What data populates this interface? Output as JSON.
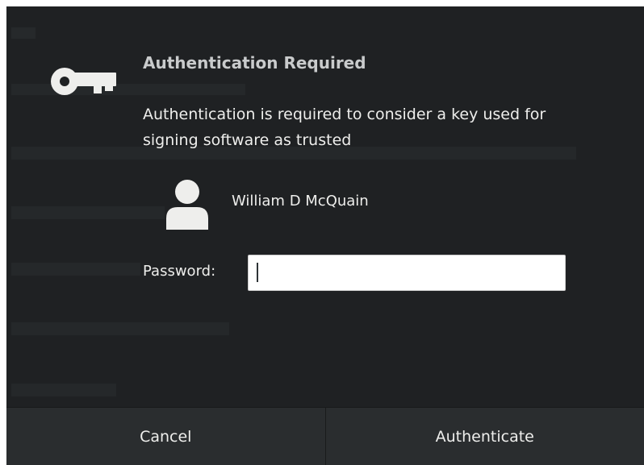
{
  "dialog": {
    "title": "Authentication Required",
    "message": "Authentication is required to consider a key used for signing software as trusted",
    "user_name": "William D McQuain",
    "password_label": "Password:",
    "password_value": "",
    "cancel_label": "Cancel",
    "authenticate_label": "Authenticate"
  },
  "icons": {
    "key": "key-icon",
    "user": "avatar-person-icon"
  },
  "colors": {
    "dialog_background": "#1f2123",
    "button_background": "#2a2d2f",
    "title_text": "#c9cbcc",
    "body_text": "#eeeeec",
    "input_background": "#ffffff"
  }
}
